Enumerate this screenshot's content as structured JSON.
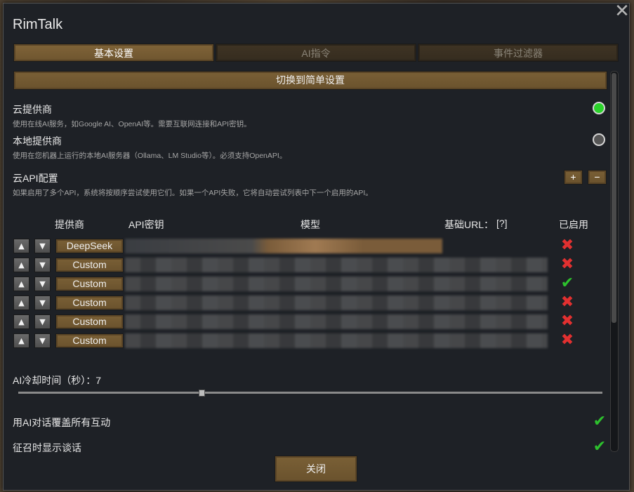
{
  "window": {
    "title": "RimTalk"
  },
  "tabs": [
    {
      "label": "基本设置",
      "active": true
    },
    {
      "label": "AI指令",
      "active": false
    },
    {
      "label": "事件过滤器",
      "active": false
    }
  ],
  "switch_button": "切换到简单设置",
  "cloud_provider": {
    "title": "云提供商",
    "desc": "使用在线AI服务，如Google AI、OpenAI等。需要互联网连接和API密钥。",
    "selected": true
  },
  "local_provider": {
    "title": "本地提供商",
    "desc": "使用在您机器上运行的本地AI服务器（Ollama、LM Studio等）。必须支持OpenAPI。",
    "selected": false
  },
  "api_config": {
    "title": "云API配置",
    "desc": "如果启用了多个API，系统将按顺序尝试使用它们。如果一个API失败，它将自动尝试列表中下一个启用的API。",
    "add_label": "+",
    "remove_label": "−"
  },
  "table": {
    "headers": {
      "provider": "提供商",
      "api_key": "API密钥",
      "model": "模型",
      "base_url": "基础URL：",
      "help": "[?]",
      "enabled": "已启用"
    },
    "up_glyph": "▲",
    "down_glyph": "▼",
    "rows": [
      {
        "provider": "DeepSeek",
        "enabled": false
      },
      {
        "provider": "Custom",
        "enabled": false
      },
      {
        "provider": "Custom",
        "enabled": true
      },
      {
        "provider": "Custom",
        "enabled": false
      },
      {
        "provider": "Custom",
        "enabled": false
      },
      {
        "provider": "Custom",
        "enabled": false
      }
    ]
  },
  "cooldown": {
    "label": "AI冷却时间（秒）：",
    "value": "7",
    "slider_fraction": 0.31
  },
  "options": [
    {
      "label": "用AI对话覆盖所有互动",
      "checked": true
    },
    {
      "label": "征召时显示谈话",
      "checked": true
    }
  ],
  "close_button": "关闭",
  "colors": {
    "accent_brown": "#7a6036",
    "radio_on": "#2bd32b",
    "check_green": "#2dc12d",
    "cross_red": "#e23030"
  }
}
